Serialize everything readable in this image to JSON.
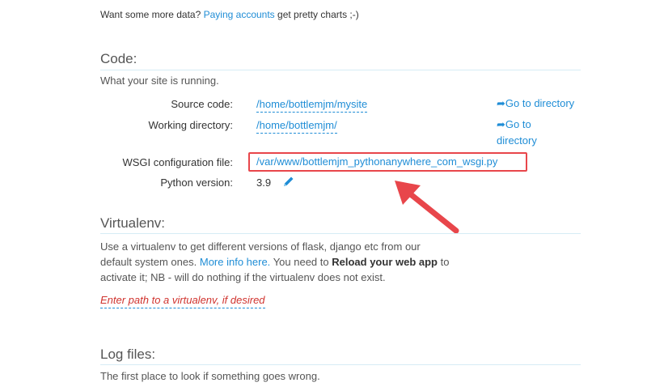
{
  "promo": {
    "prefix": "Want some more data?",
    "link": "Paying accounts",
    "suffix": "get pretty charts ;-)"
  },
  "code": {
    "title": "Code:",
    "description": "What your site is running.",
    "source_label": "Source code:",
    "source_value": "/home/bottlemjm/mysite",
    "source_goto": "Go to directory",
    "working_label": "Working directory:",
    "working_value": "/home/bottlemjm/",
    "working_goto_line1": "Go to",
    "working_goto_line2": "directory",
    "wsgi_label": "WSGI configuration file:",
    "wsgi_value": "/var/www/bottlemjm_pythonanywhere_com_wsgi.py",
    "python_label": "Python version:",
    "python_value": "3.9"
  },
  "virtualenv": {
    "title": "Virtualenv:",
    "desc_line1": "Use a virtualenv to get different versions of flask, django etc from our",
    "desc_line2_a": "default system ones.",
    "desc_line2_link": "More info here.",
    "desc_line2_b": "You need to",
    "desc_line2_bold": "Reload your web app",
    "desc_line2_c": "to",
    "desc_line3": "activate it; NB - will do nothing if the virtualenv does not exist.",
    "input_placeholder": "Enter path to a virtualenv, if desired"
  },
  "logfiles": {
    "title": "Log files:",
    "description": "The first place to look if something goes wrong."
  },
  "colors": {
    "link": "#1f8dd6",
    "highlight": "#e8464b",
    "placeholder": "#d0332e"
  }
}
